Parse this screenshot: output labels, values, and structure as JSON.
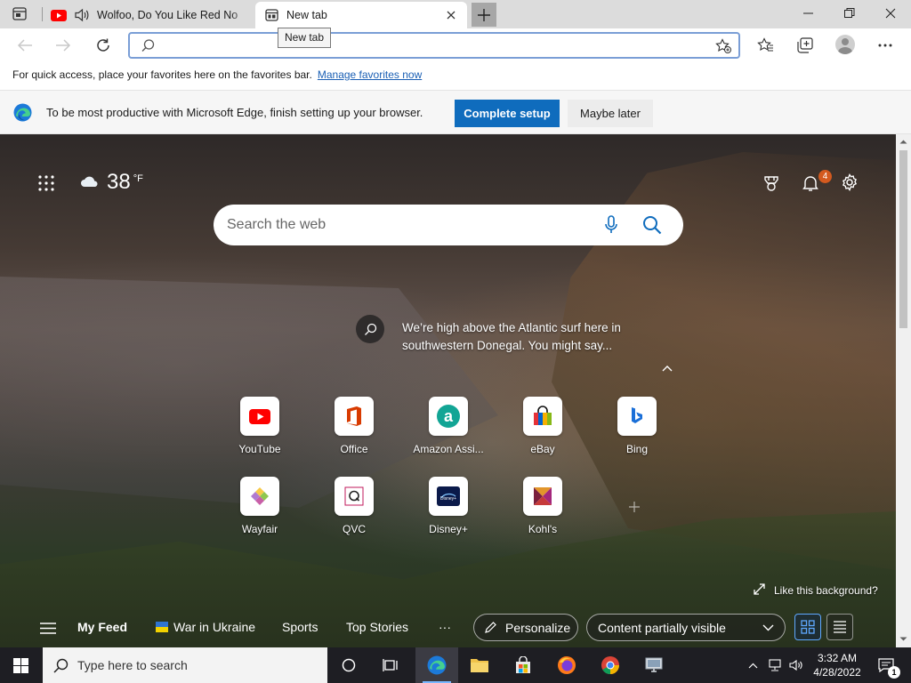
{
  "tabs": [
    {
      "title": "Wolfoo, Do You Like Red No",
      "favicon": "youtube-icon",
      "audio": true
    },
    {
      "title": "New tab",
      "favicon": "newtab-page-icon",
      "active": true
    }
  ],
  "tooltip": "New tab",
  "address_bar": {
    "value": "",
    "placeholder": ""
  },
  "favorites_bar": {
    "message": "For quick access, place your favorites here on the favorites bar.",
    "link": "Manage favorites now"
  },
  "banner": {
    "message": "To be most productive with Microsoft Edge, finish setting up your browser.",
    "primary": "Complete setup",
    "secondary": "Maybe later"
  },
  "ntp": {
    "weather": {
      "temp": "38",
      "unit": "°F"
    },
    "notifications_count": "4",
    "search_placeholder": "Search the web",
    "caption_line1": "We’re high above the Atlantic surf here in",
    "caption_line2": "southwestern Donegal. You might say...",
    "quick_links": [
      {
        "label": "YouTube"
      },
      {
        "label": "Office"
      },
      {
        "label": "Amazon Assi..."
      },
      {
        "label": "eBay"
      },
      {
        "label": "Bing"
      },
      {
        "label": "Wayfair"
      },
      {
        "label": "QVC"
      },
      {
        "label": "Disney+"
      },
      {
        "label": "Kohl's"
      }
    ],
    "like_background": "Like this background?",
    "feed": {
      "my_feed": "My Feed",
      "topics": [
        "War in Ukraine",
        "Sports",
        "Top Stories"
      ],
      "more": "···",
      "personalize": "Personalize",
      "content_select": "Content partially visible"
    }
  },
  "taskbar": {
    "search_placeholder": "Type here to search",
    "time": "3:32 AM",
    "date": "4/28/2022",
    "notification_count": "1"
  },
  "colors": {
    "accent": "#0f6cbd",
    "youtube_red": "#ff0000",
    "notif_badge": "#d45a1f"
  }
}
